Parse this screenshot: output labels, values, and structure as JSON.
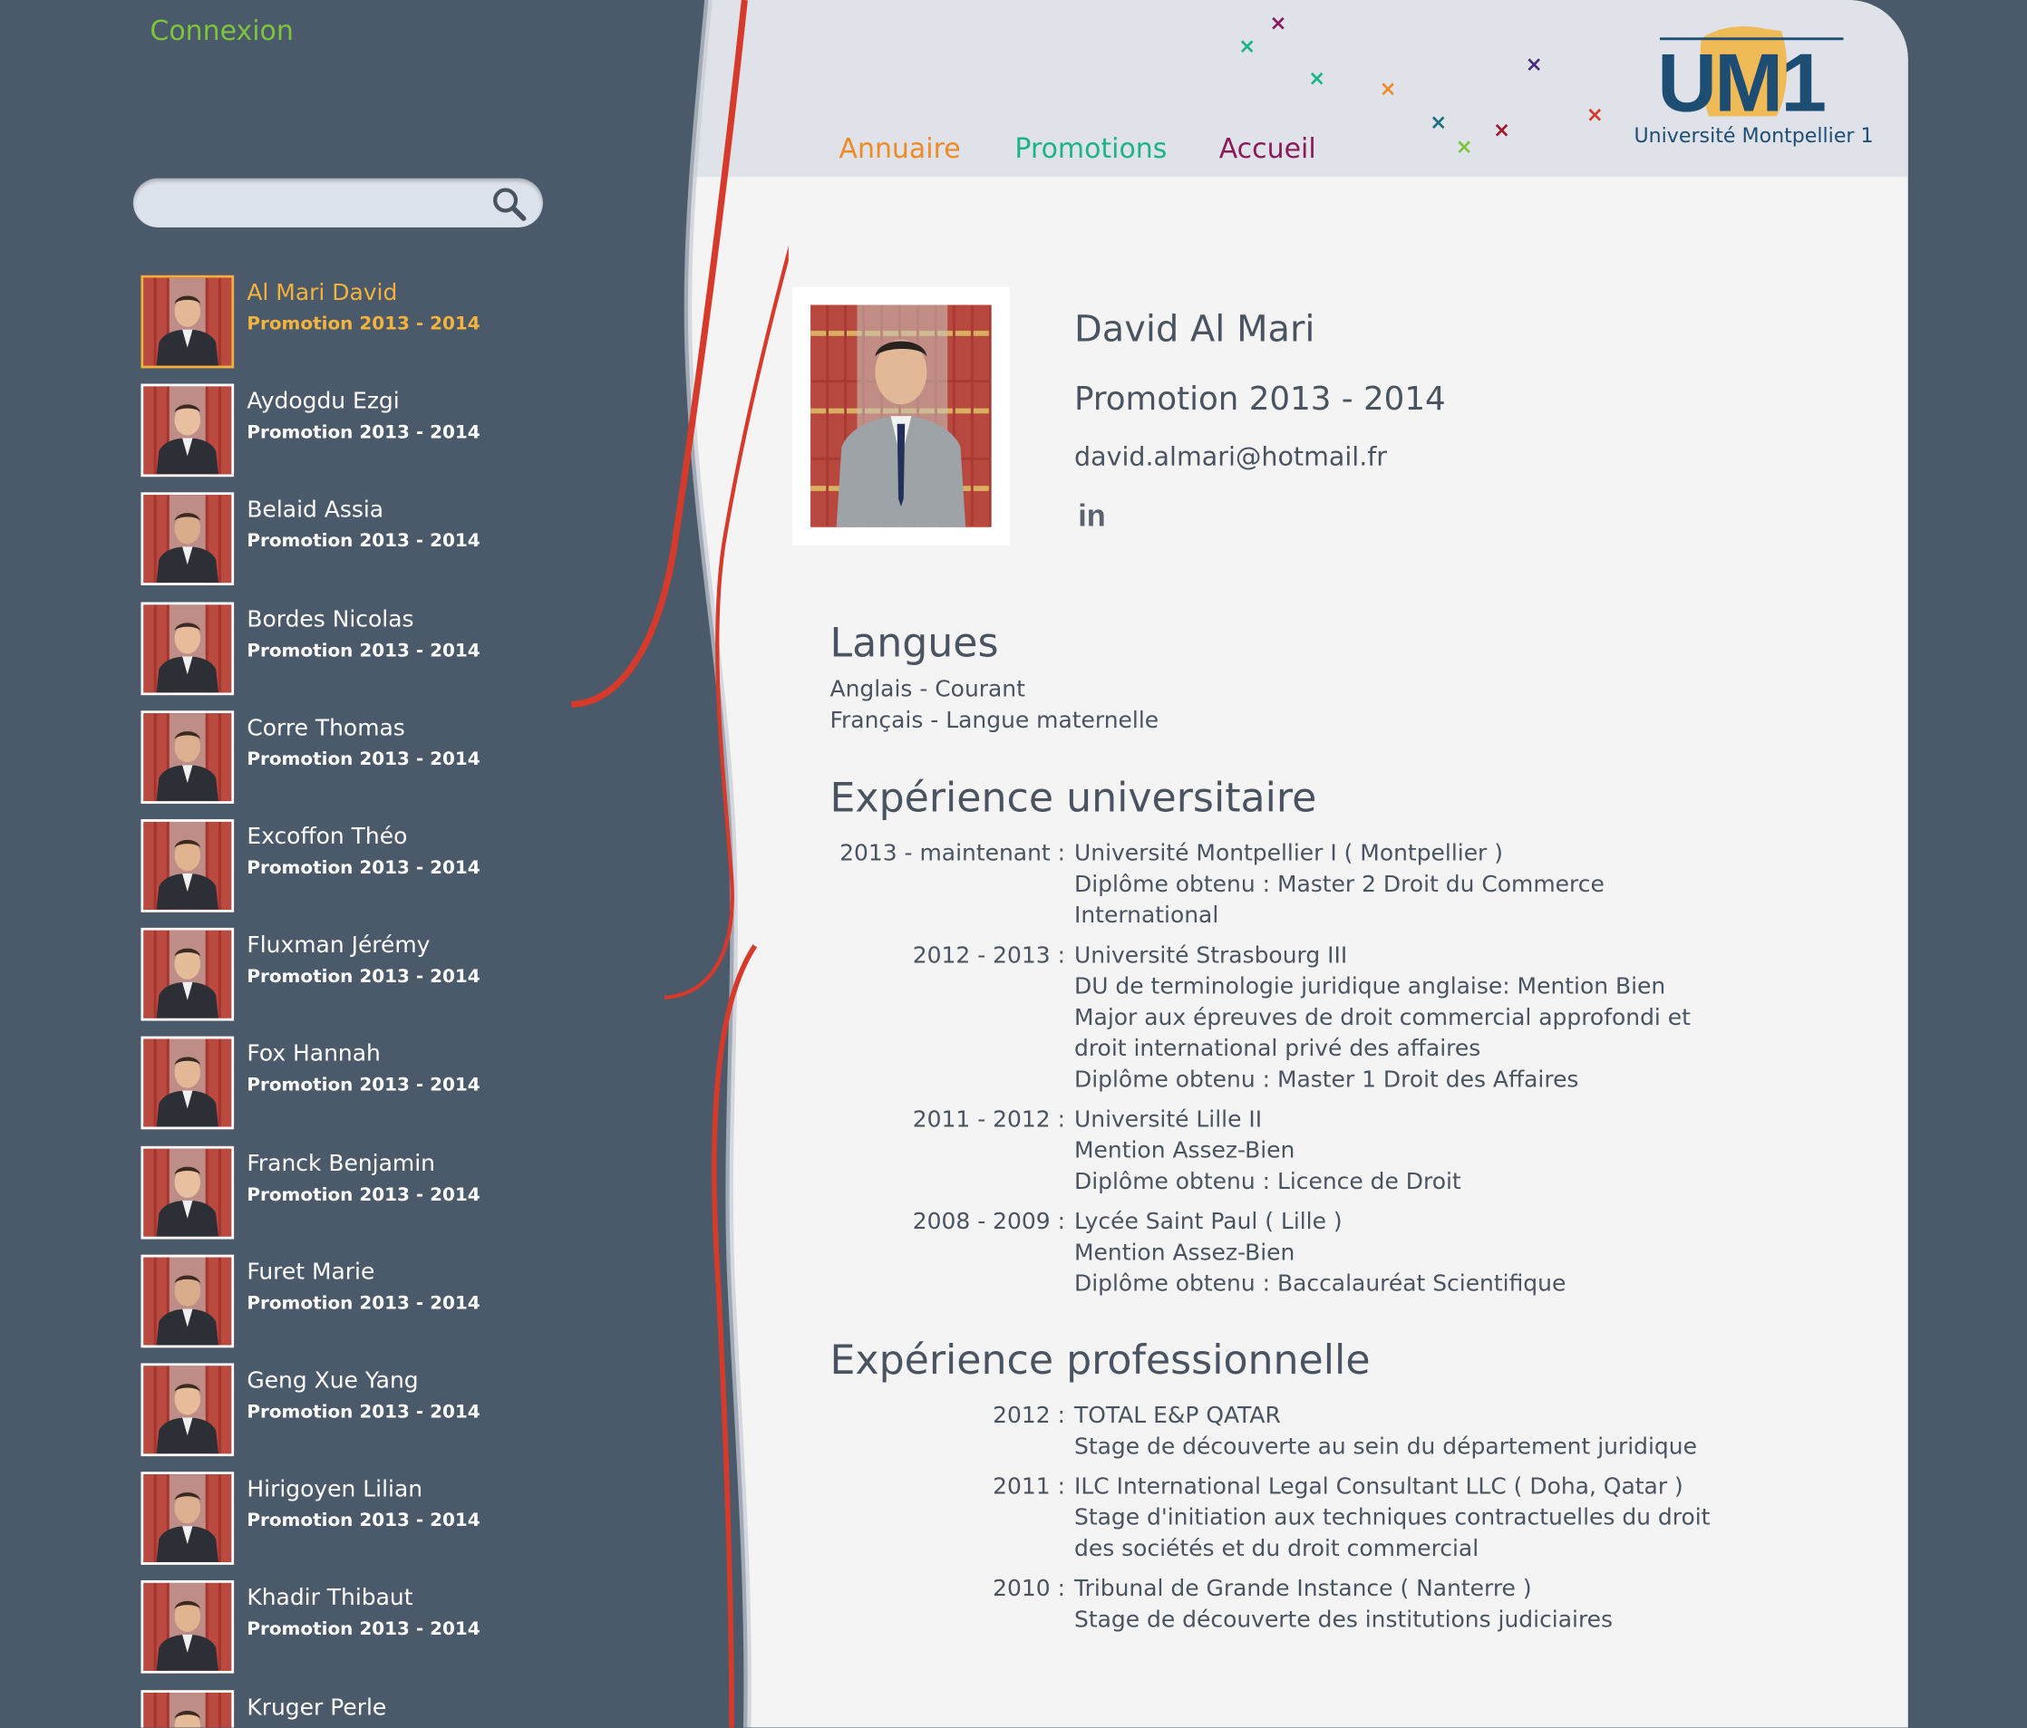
{
  "sidebar": {
    "login_label": "Connexion",
    "search_placeholder": "",
    "people": [
      {
        "name": "Al Mari David",
        "promo": "Promotion 2013 - 2014"
      },
      {
        "name": "Aydogdu Ezgi",
        "promo": "Promotion 2013 - 2014"
      },
      {
        "name": "Belaid Assia",
        "promo": "Promotion 2013 - 2014"
      },
      {
        "name": "Bordes Nicolas",
        "promo": "Promotion 2013 - 2014"
      },
      {
        "name": "Corre Thomas",
        "promo": "Promotion 2013 - 2014"
      },
      {
        "name": "Excoffon Théo",
        "promo": "Promotion 2013 - 2014"
      },
      {
        "name": "Fluxman Jérémy",
        "promo": "Promotion 2013 - 2014"
      },
      {
        "name": "Fox Hannah",
        "promo": "Promotion 2013 - 2014"
      },
      {
        "name": "Franck Benjamin",
        "promo": "Promotion 2013 - 2014"
      },
      {
        "name": "Furet Marie",
        "promo": "Promotion 2013 - 2014"
      },
      {
        "name": "Geng Xue Yang",
        "promo": "Promotion 2013 - 2014"
      },
      {
        "name": "Hirigoyen Lilian",
        "promo": "Promotion 2013 - 2014"
      },
      {
        "name": "Khadir Thibaut",
        "promo": "Promotion 2013 - 2014"
      },
      {
        "name": "Kruger Perle",
        "promo": ""
      }
    ]
  },
  "header": {
    "nav": {
      "annuaire": "Annuaire",
      "promotions": "Promotions",
      "accueil": "Accueil"
    },
    "logo_text": "UM1",
    "logo_tagline": "Université Montpellier 1"
  },
  "profile": {
    "name": "David Al Mari",
    "promotion": "Promotion 2013 - 2014",
    "email": "david.almari@hotmail.fr",
    "linkedin_label": "in"
  },
  "languages": {
    "title": "Langues",
    "items": [
      "Anglais - Courant",
      "Français - Langue maternelle"
    ]
  },
  "university": {
    "title": "Expérience universitaire",
    "entries": [
      {
        "date": "2013 - maintenant :",
        "lines": [
          "Université Montpellier I ( Montpellier )",
          "Diplôme obtenu : Master 2 Droit du Commerce",
          "International"
        ]
      },
      {
        "date": "2012 - 2013 :",
        "lines": [
          "Université Strasbourg III",
          "DU de terminologie juridique anglaise: Mention Bien",
          "Major aux épreuves de droit commercial approfondi et",
          "droit international privé des affaires",
          "Diplôme obtenu : Master 1 Droit des Affaires"
        ]
      },
      {
        "date": "2011 - 2012 :",
        "lines": [
          "Université Lille II",
          "Mention Assez-Bien",
          "Diplôme obtenu : Licence de Droit"
        ]
      },
      {
        "date": "2008 - 2009 :",
        "lines": [
          "Lycée Saint Paul ( Lille )",
          "Mention Assez-Bien",
          "Diplôme obtenu : Baccalauréat Scientifique"
        ]
      }
    ]
  },
  "professional": {
    "title": "Expérience professionnelle",
    "entries": [
      {
        "date": "2012 :",
        "lines": [
          "TOTAL E&P QATAR",
          "Stage de découverte au sein du département juridique"
        ]
      },
      {
        "date": "2011 :",
        "lines": [
          "ILC International Legal Consultant LLC ( Doha, Qatar )",
          "Stage d'initiation aux techniques contractuelles du droit",
          "des sociétés et du droit commercial"
        ]
      },
      {
        "date": "2010 :",
        "lines": [
          "Tribunal de Grande Instance ( Nanterre )",
          "Stage de découverte des institutions judiciaires"
        ]
      }
    ]
  },
  "colors": {
    "background": "#4a5a6a",
    "content_bg": "#f4f4f4",
    "header_band": "#dfe3e9",
    "text": "#4a5360",
    "active_accent": "#f3b33d",
    "login_green": "#7cc43b",
    "nav_orange": "#f08a24",
    "nav_teal": "#1db38a",
    "nav_purple": "#8b1a5a",
    "ribbon_red": "#d63a2a"
  }
}
